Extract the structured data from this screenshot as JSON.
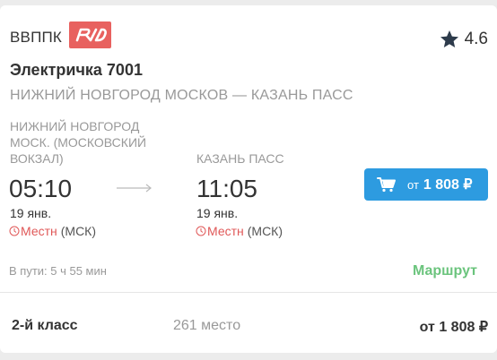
{
  "carrier": {
    "name": "ВВППК",
    "logo_icon": "rzd-logo",
    "logo_color": "#e8615f"
  },
  "rating": {
    "icon": "star-icon",
    "value": "4.6"
  },
  "train": {
    "name": "Электричка 7001",
    "route": "НИЖНИЙ НОВГОРОД МОСКОВ — КАЗАНЬ ПАСС"
  },
  "departure": {
    "station": "НИЖНИЙ НОВГОРОД МОСК. (МОСКОВСКИЙ ВОКЗАЛ)",
    "time": "05:10",
    "date": "19 янв.",
    "tz_local": "Местн",
    "tz_msk": "(МСК)"
  },
  "arrival": {
    "station": "КАЗАНЬ ПАСС",
    "time": "11:05",
    "date": "19 янв.",
    "tz_local": "Местн",
    "tz_msk": "(МСК)"
  },
  "buy_button": {
    "prefix": "от",
    "price": "1 808 ₽",
    "icon": "cart-icon"
  },
  "duration": "В пути: 5 ч 55 мин",
  "route_link": "Маршрут",
  "ticket_class": {
    "name": "2-й класс",
    "seats": "261 место",
    "price": "от 1 808 ₽"
  },
  "colors": {
    "accent": "#2d9be0",
    "link_green": "#6bc47d",
    "local_red": "#e05858"
  }
}
